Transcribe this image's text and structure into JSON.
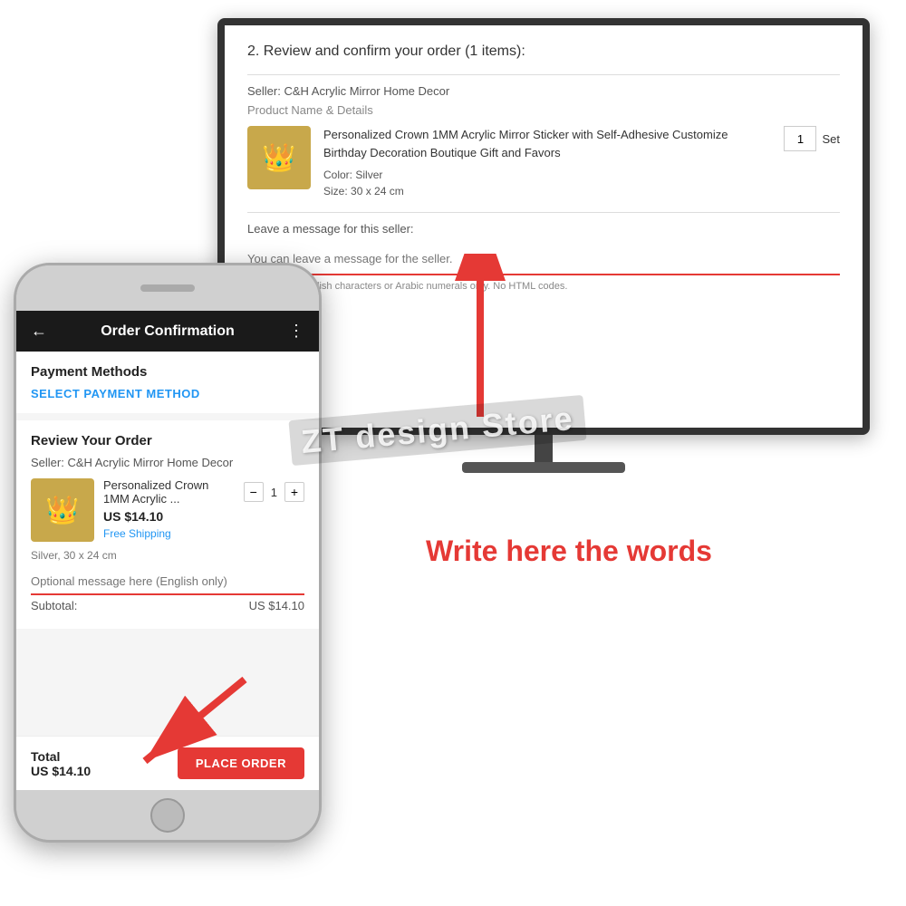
{
  "monitor": {
    "section_title": "2. Review and confirm your order (1 items):",
    "seller_label": "Seller: C&H Acrylic Mirror Home Decor",
    "product_label": "Product Name & Details",
    "product_name": "Personalized Crown 1MM Acrylic Mirror Sticker with Self-Adhesive Customize Birthday Decoration Boutique Gift and Favors",
    "product_color_label": "Color:",
    "product_color_value": "Silver",
    "product_size_label": "Size:",
    "product_size_value": "30 x 24 cm",
    "quantity": "1",
    "quantity_unit": "Set",
    "message_label": "Leave a message for this seller:",
    "message_placeholder": "You can leave a message for the seller.",
    "message_hint": "Max. 1,000 English characters or Arabic numerals only. No HTML codes."
  },
  "phone": {
    "header_title": "Order Confirmation",
    "back_icon": "←",
    "more_icon": "⋮",
    "payment_section_title": "Payment Methods",
    "select_payment_label": "SELECT PAYMENT METHOD",
    "review_section_title": "Review Your Order",
    "seller_label": "Seller: C&H Acrylic Mirror Home Decor",
    "product_name": "Personalized Crown 1MM Acrylic ...",
    "product_price": "US $14.10",
    "shipping_label": "Free Shipping",
    "quantity": "1",
    "qty_minus": "−",
    "qty_plus": "+",
    "variant_label": "Silver, 30 x 24 cm",
    "message_placeholder": "Optional message here (English only)",
    "subtotal_label": "Subtotal:",
    "subtotal_value": "US $14.10",
    "total_label": "Total",
    "total_value": "US $14.10",
    "place_order_label": "PLACE ORDER"
  },
  "watermark": {
    "text": "ZT design Store"
  },
  "call_to_action": {
    "text": "Write here the words"
  },
  "arrows": {
    "desktop_arrow_label": "arrow pointing to desktop message field",
    "mobile_arrow_label": "arrow pointing to mobile message field"
  }
}
